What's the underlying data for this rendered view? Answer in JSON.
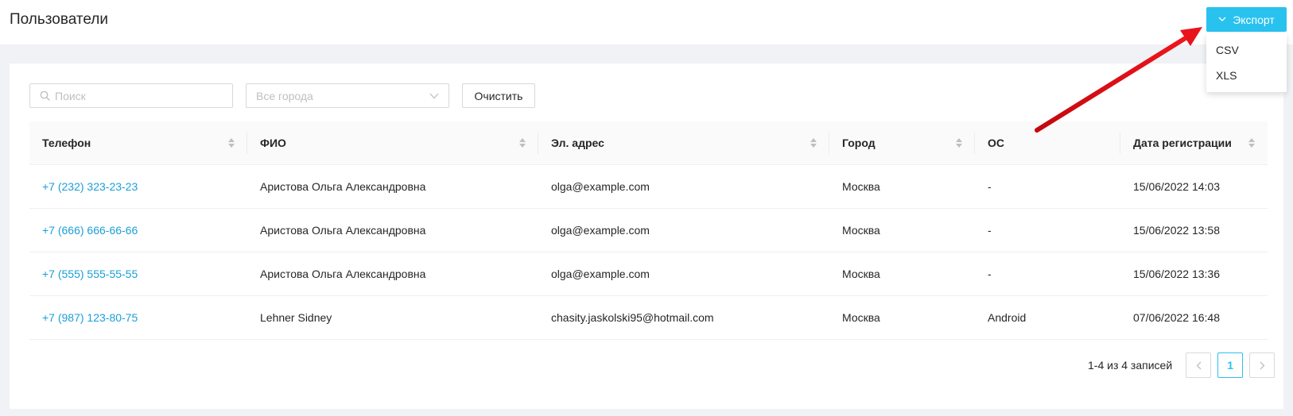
{
  "header": {
    "title": "Пользователи",
    "export_label": "Экспорт",
    "export_options": [
      "CSV",
      "XLS"
    ],
    "accent_color": "#29c2ee"
  },
  "filters": {
    "search_placeholder": "Поиск",
    "city_placeholder": "Все города",
    "clear_label": "Очистить"
  },
  "table": {
    "columns": [
      "Телефон",
      "ФИО",
      "Эл. адрес",
      "Город",
      "ОС",
      "Дата регистрации"
    ],
    "rows": [
      {
        "phone": "+7 (232) 323-23-23",
        "name": "Аристова Ольга Александровна",
        "email": "olga@example.com",
        "city": "Москва",
        "os": "-",
        "date": "15/06/2022 14:03"
      },
      {
        "phone": "+7 (666) 666-66-66",
        "name": "Аристова Ольга Александровна",
        "email": "olga@example.com",
        "city": "Москва",
        "os": "-",
        "date": "15/06/2022 13:58"
      },
      {
        "phone": "+7 (555) 555-55-55",
        "name": "Аристова Ольга Александровна",
        "email": "olga@example.com",
        "city": "Москва",
        "os": "-",
        "date": "15/06/2022 13:36"
      },
      {
        "phone": "+7 (987) 123-80-75",
        "name": "Lehner Sidney",
        "email": "chasity.jaskolski95@hotmail.com",
        "city": "Москва",
        "os": "Android",
        "date": "07/06/2022 16:48"
      }
    ]
  },
  "pagination": {
    "total_label": "1-4 из 4 записей",
    "current_page": "1"
  },
  "annotation": {
    "arrow_color": "#e8141c"
  }
}
